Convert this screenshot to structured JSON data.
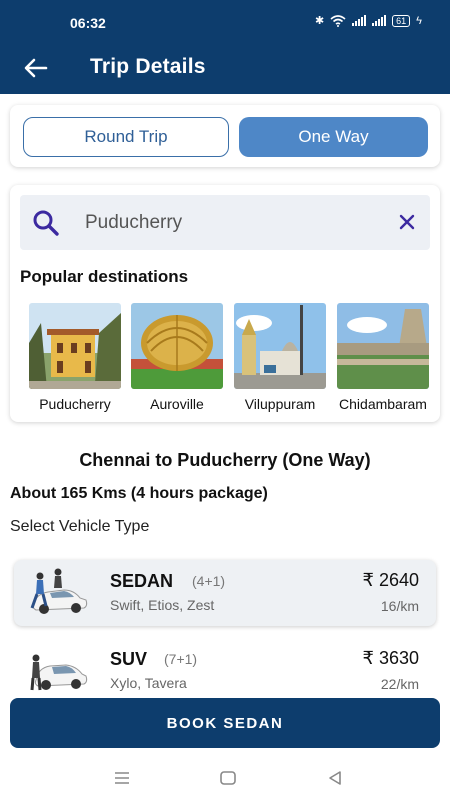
{
  "status": {
    "time": "06:32",
    "battery": "61"
  },
  "appbar": {
    "title": "Trip Details",
    "back_icon": "arrow-left-icon"
  },
  "trip_type": {
    "round_label": "Round Trip",
    "oneway_label": "One Way",
    "selected": "One Way"
  },
  "search": {
    "value": "Puducherry"
  },
  "popular": {
    "heading": "Popular destinations",
    "items": [
      {
        "label": "Puducherry"
      },
      {
        "label": "Auroville"
      },
      {
        "label": "Viluppuram"
      },
      {
        "label": "Chidambaram"
      }
    ]
  },
  "trip": {
    "route": "Chennai to Puducherry (One Way)",
    "distance": "About 165 Kms (4 hours package)",
    "select_label": "Select Vehicle Type"
  },
  "vehicles": [
    {
      "name": "SEDAN",
      "capacity": "(4+1)",
      "models": "Swift, Etios, Zest",
      "price": "₹ 2640",
      "rate": "16/km",
      "selected": true
    },
    {
      "name": "SUV",
      "capacity": "(7+1)",
      "models": "Xylo, Tavera",
      "price": "₹ 3630",
      "rate": "22/km",
      "selected": false
    }
  ],
  "book_button": {
    "label": "BOOK SEDAN"
  },
  "colors": {
    "primary": "#0d3d6d",
    "accent": "#4e87c7",
    "search_icon": "#3c2aa0"
  }
}
